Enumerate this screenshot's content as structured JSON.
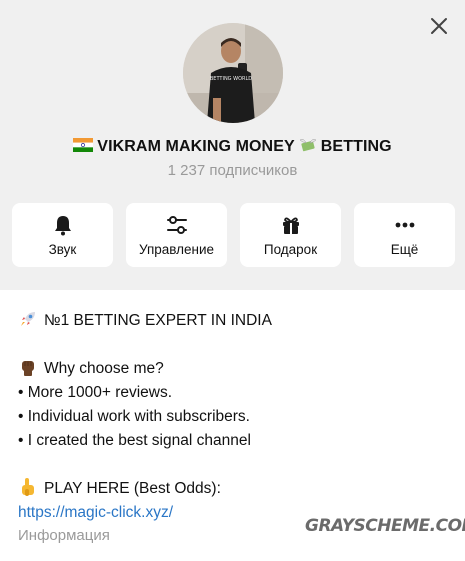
{
  "header": {
    "channel_name_text": "VIKRAM MAKING MONEY",
    "channel_name_suffix": "BETTING",
    "subscribers": "1 237 подписчиков",
    "shirt_text": "BETTING WORLD"
  },
  "actions": [
    {
      "label": "Звук",
      "icon": "bell-icon"
    },
    {
      "label": "Управление",
      "icon": "sliders-icon"
    },
    {
      "label": "Подарок",
      "icon": "gift-icon"
    },
    {
      "label": "Ещё",
      "icon": "more-icon"
    }
  ],
  "description": {
    "line1": "№1 BETTING EXPERT IN INDIA",
    "line2": "Why choose me?",
    "line3": "• More 1000+ reviews.",
    "line4": "• Individual work with subscribers.",
    "line5": "• I created the best signal channel",
    "line6": "PLAY HERE (Best Odds):",
    "link": "https://magic-click.xyz/"
  },
  "info_label": "Информация",
  "watermark": "GRAYSCHEME.COM",
  "colors": {
    "header_bg": "#f0f0f0",
    "link": "#2a76c6",
    "muted": "#9a9a9a"
  }
}
